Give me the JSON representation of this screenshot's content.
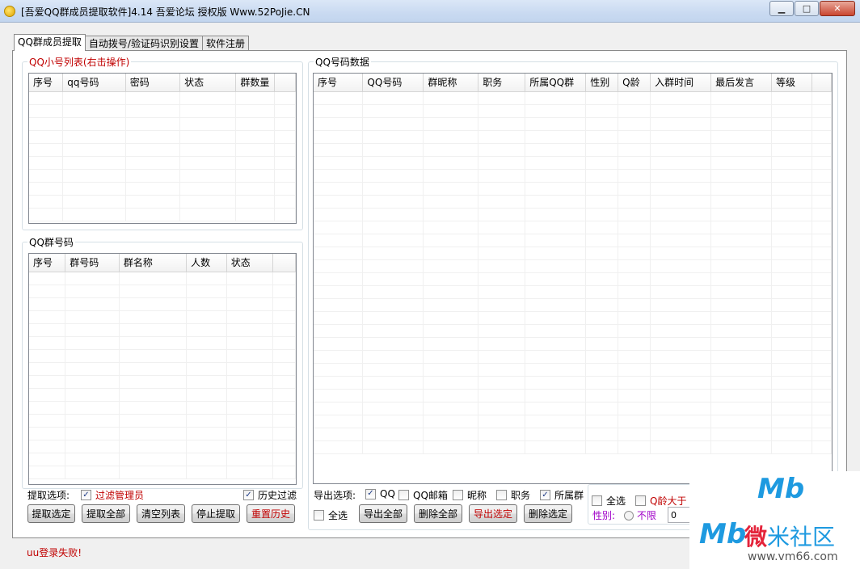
{
  "window": {
    "title": "[吾爱QQ群成员提取软件]4.14 吾爱论坛 授权版  Www.52PoJie.CN",
    "minimize": "▁",
    "maximize": "□",
    "close": "✕"
  },
  "tabs": [
    {
      "label": "QQ群成员提取",
      "active": true
    },
    {
      "label": "自动拨号/验证码识别设置",
      "active": false
    },
    {
      "label": "软件注册",
      "active": false
    }
  ],
  "account_list": {
    "title": "QQ小号列表(右击操作)",
    "columns": [
      "序号",
      "qq号码",
      "密码",
      "状态",
      "群数量"
    ]
  },
  "group_list": {
    "title": "QQ群号码",
    "columns": [
      "序号",
      "群号码",
      "群名称",
      "人数",
      "状态"
    ]
  },
  "member_data": {
    "title": "QQ号码数据",
    "columns": [
      "序号",
      "QQ号码",
      "群昵称",
      "职务",
      "所属QQ群",
      "性别",
      "Q龄",
      "入群时间",
      "最后发言",
      "等级"
    ]
  },
  "extract_options": {
    "label": "提取选项:",
    "filter_admin": {
      "label": "过滤管理员",
      "checked": true
    },
    "history_filter": {
      "label": "历史过滤",
      "checked": true
    }
  },
  "left_buttons": {
    "extract_selected": "提取选定",
    "extract_all": "提取全部",
    "clear_list": "清空列表",
    "stop_extract": "停止提取",
    "reset_history": "重置历史"
  },
  "export_options": {
    "label": "导出选项:",
    "qq": {
      "label": "QQ",
      "checked": true
    },
    "qq_mail": {
      "label": "QQ邮箱",
      "checked": false
    },
    "nickname": {
      "label": "昵称",
      "checked": false
    },
    "position": {
      "label": "职务",
      "checked": false
    },
    "group": {
      "label": "所属群",
      "checked": true
    },
    "select_all": {
      "label": "全选",
      "checked": false
    }
  },
  "right_buttons": {
    "export_all": "导出全部",
    "delete_all": "删除全部",
    "export_selected": "导出选定",
    "delete_selected": "删除选定"
  },
  "filter_panel": {
    "select_all": {
      "label": "全选",
      "checked": false
    },
    "age_greater": {
      "label": "Q龄大于",
      "checked": false
    },
    "gender_label": "性别:",
    "gender_option": "不限",
    "age_value": "0"
  },
  "status": "uu登录失败!",
  "watermark": {
    "logo": "Mb",
    "site_name_first": "微",
    "site_name_rest": "米社区",
    "url": "www.vm66.com"
  },
  "check_mark": "✓"
}
